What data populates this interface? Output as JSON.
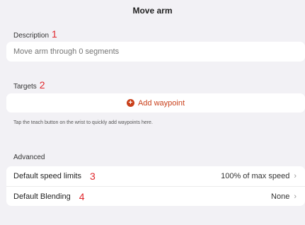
{
  "header": {
    "title": "Move arm"
  },
  "description": {
    "label": "Description",
    "marker": "1",
    "placeholder": "Move arm through 0 segments"
  },
  "targets": {
    "label": "Targets",
    "marker": "2",
    "add_button_label": "Add waypoint",
    "add_icon": "plus-circle-icon",
    "hint": "Tap the teach button on the wrist to quickly add waypoints here."
  },
  "advanced": {
    "label": "Advanced",
    "rows": [
      {
        "label": "Default speed limits",
        "marker": "3",
        "value": "100% of max speed"
      },
      {
        "label": "Default Blending",
        "marker": "4",
        "value": "None"
      }
    ]
  },
  "colors": {
    "accent": "#c9401b",
    "marker": "#e0262b",
    "background": "#f2f1f5"
  }
}
